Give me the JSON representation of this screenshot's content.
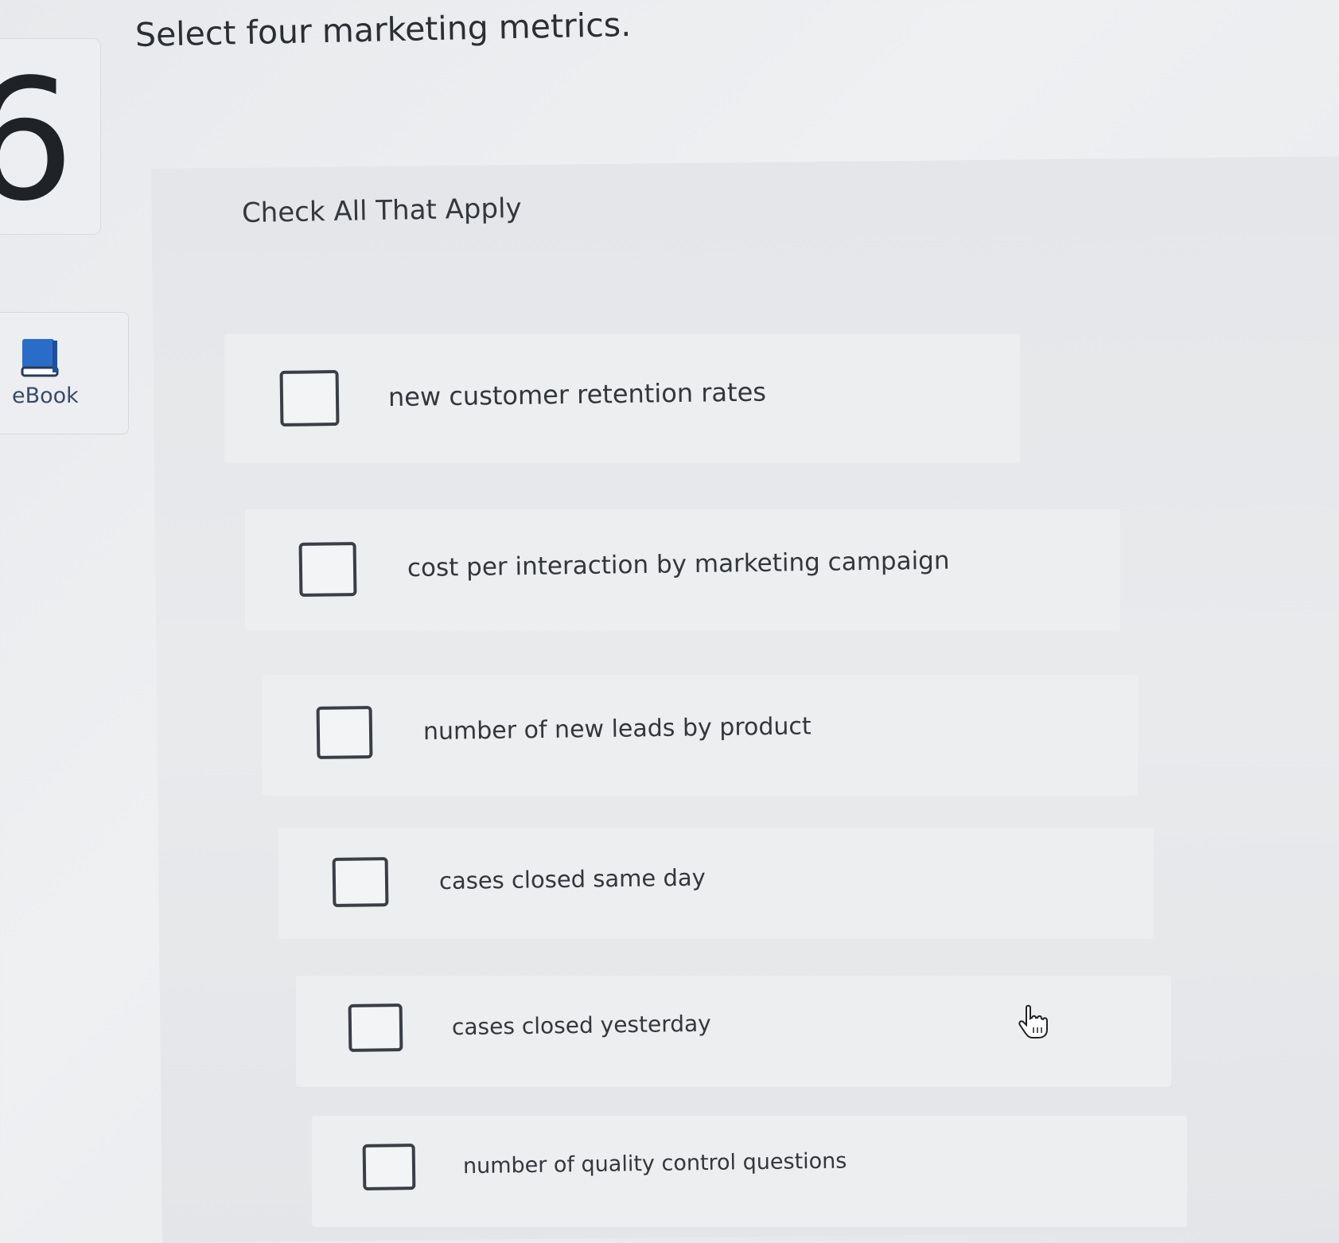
{
  "question": {
    "number": "6",
    "title": "Select four marketing metrics."
  },
  "sidebar": {
    "ebook_label": "eBook",
    "ebook_icon": "book-icon"
  },
  "instructions": "Check All That Apply",
  "options": [
    {
      "label": "new customer retention rates",
      "checked": false
    },
    {
      "label": "cost per interaction by marketing campaign",
      "checked": false
    },
    {
      "label": "number of new leads by product",
      "checked": false
    },
    {
      "label": "cases closed same day",
      "checked": false
    },
    {
      "label": "cases closed yesterday",
      "checked": false
    },
    {
      "label": "number of quality control questions",
      "checked": false
    }
  ],
  "colors": {
    "accent_book": "#2a6dc8",
    "checkbox_border": "#3a3e45"
  }
}
